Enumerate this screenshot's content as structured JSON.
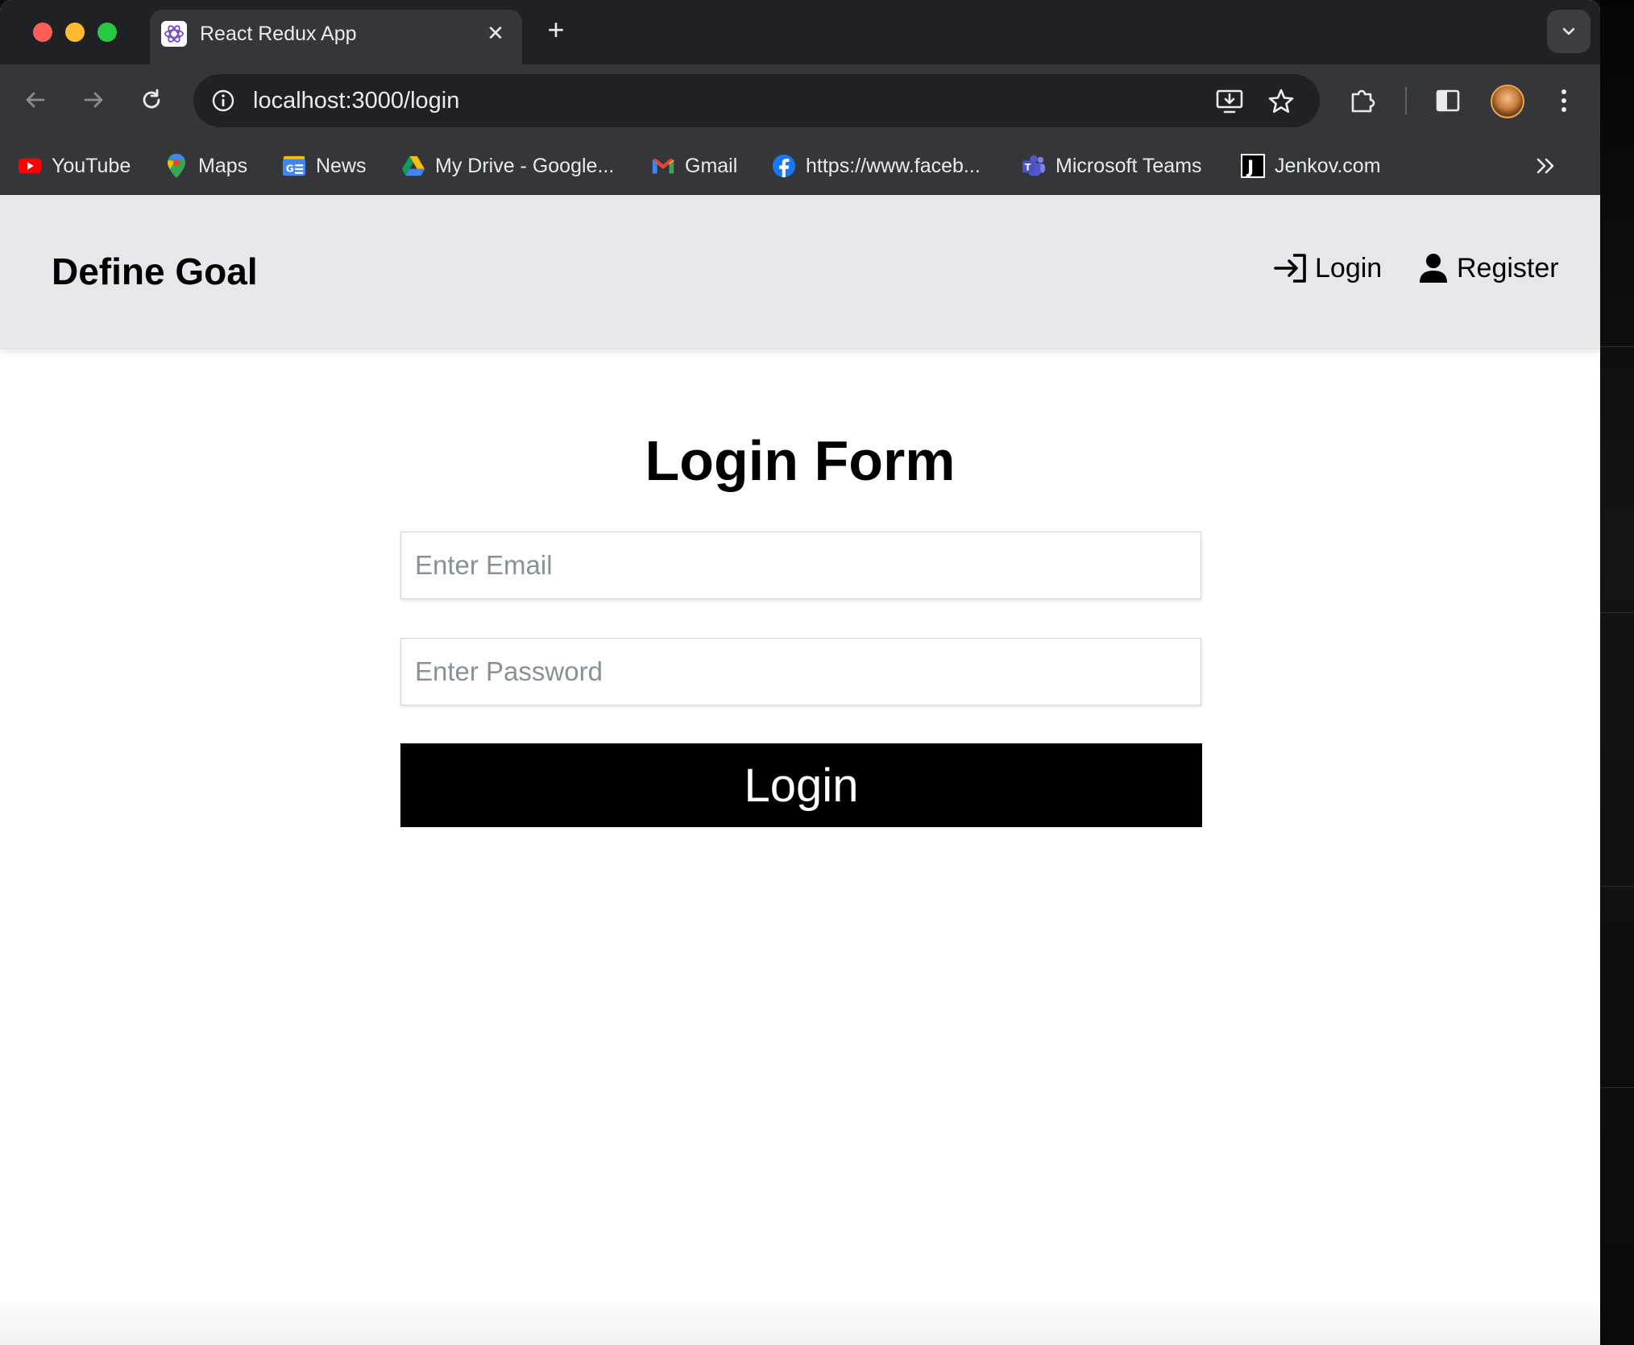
{
  "browser": {
    "tab_title": "React Redux App",
    "tab_close": "✕",
    "new_tab": "+",
    "url": "localhost:3000/login",
    "bookmarks": [
      {
        "label": "YouTube",
        "icon": "youtube-icon"
      },
      {
        "label": "Maps",
        "icon": "maps-icon"
      },
      {
        "label": "News",
        "icon": "news-icon"
      },
      {
        "label": "My Drive - Google...",
        "icon": "drive-icon"
      },
      {
        "label": "Gmail",
        "icon": "gmail-icon"
      },
      {
        "label": "https://www.faceb...",
        "icon": "facebook-icon"
      },
      {
        "label": "Microsoft Teams",
        "icon": "teams-icon"
      },
      {
        "label": "Jenkov.com",
        "icon": "jenkov-icon"
      }
    ],
    "colors": {
      "tabstrip": "#202124",
      "toolbar": "#35363a",
      "text": "#e8eaed"
    }
  },
  "site": {
    "brand": "Define Goal",
    "nav": {
      "login_label": "Login",
      "register_label": "Register"
    },
    "header_bg": "#e5e7eb"
  },
  "form": {
    "title": "Login Form",
    "email_placeholder": "Enter Email",
    "email_value": "",
    "password_placeholder": "Enter Password",
    "password_value": "",
    "submit_label": "Login",
    "submit_bg": "#000000"
  }
}
